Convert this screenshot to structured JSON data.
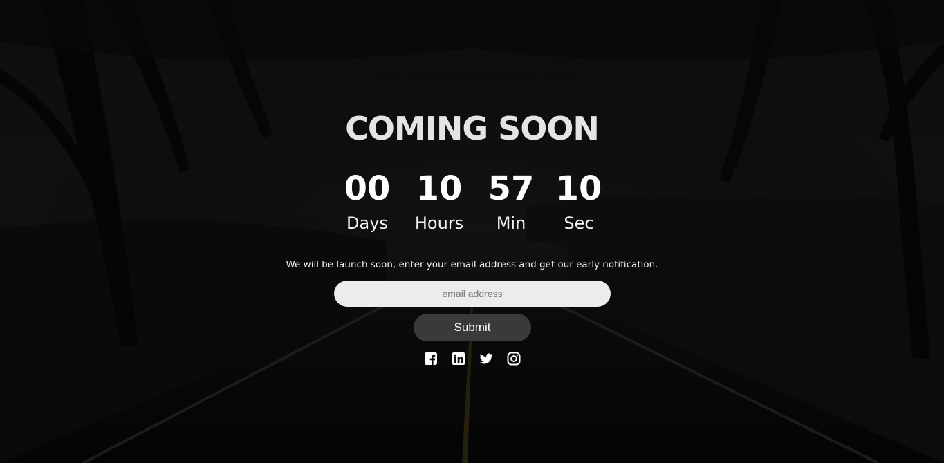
{
  "page": {
    "title": "COMING SOON",
    "notice": "We will be launch soon, enter your email address and get our early notification."
  },
  "countdown": [
    {
      "value": "00",
      "unit": "Days"
    },
    {
      "value": "10",
      "unit": "Hours"
    },
    {
      "value": "57",
      "unit": "Min"
    },
    {
      "value": "10",
      "unit": "Sec"
    }
  ],
  "form": {
    "email_placeholder": "email address",
    "email_value": "",
    "submit_label": "Submit"
  },
  "social": [
    {
      "icon": "facebook-icon"
    },
    {
      "icon": "linkedin-icon"
    },
    {
      "icon": "twitter-icon"
    },
    {
      "icon": "instagram-icon"
    }
  ],
  "colors": {
    "title": "#e4e4e4",
    "text": "#ffffff",
    "input_bg": "#ececec",
    "button_bg": "#3a3a3b",
    "overlay": "#0a0a0b"
  }
}
